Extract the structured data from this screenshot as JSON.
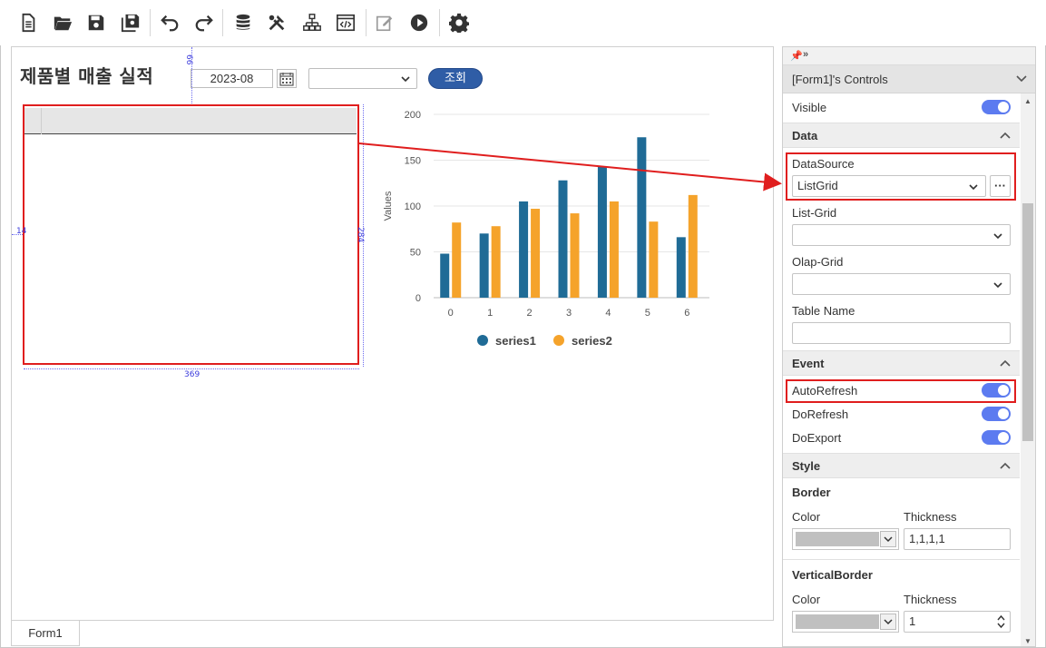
{
  "toolbar": {
    "icons": [
      "new-file-icon",
      "open-folder-icon",
      "save-icon",
      "save-all-icon",
      "undo-icon",
      "redo-icon",
      "database-icon",
      "tools-icon",
      "hierarchy-icon",
      "code-icon",
      "edit-icon",
      "run-icon",
      "settings-icon"
    ]
  },
  "form": {
    "title": "제품별 매출 실적",
    "date_value": "2023-08",
    "select_value": "",
    "query_button": "조회",
    "dim_top": "66",
    "dim_left": "14",
    "dim_height": "284",
    "dim_width": "369"
  },
  "chart_data": {
    "type": "bar",
    "categories": [
      "0",
      "1",
      "2",
      "3",
      "4",
      "5",
      "6"
    ],
    "series": [
      {
        "name": "series1",
        "color": "#1f6b96",
        "values": [
          48,
          70,
          105,
          128,
          143,
          175,
          66
        ]
      },
      {
        "name": "series2",
        "color": "#f5a32b",
        "values": [
          82,
          78,
          97,
          92,
          105,
          83,
          112
        ]
      }
    ],
    "ylabel": "Values",
    "ylim": [
      0,
      200
    ],
    "yticks": [
      "0",
      "50",
      "100",
      "150",
      "200"
    ],
    "grid": true,
    "legend": "bottom"
  },
  "tabs": {
    "form1": "Form1"
  },
  "panel": {
    "title": "[Form1]'s Controls",
    "visible_label": "Visible",
    "data_header": "Data",
    "datasource_label": "DataSource",
    "datasource_value": "ListGrid",
    "ellipsis": "···",
    "listgrid_label": "List-Grid",
    "olapgrid_label": "Olap-Grid",
    "tablename_label": "Table Name",
    "event_header": "Event",
    "autorefresh_label": "AutoRefresh",
    "dorefresh_label": "DoRefresh",
    "doexport_label": "DoExport",
    "style_header": "Style",
    "border_label": "Border",
    "color_label": "Color",
    "thickness_label": "Thickness",
    "border_thickness": "1,1,1,1",
    "verticalborder_label": "VerticalBorder",
    "color_label2": "Color",
    "thickness_label2": "Thickness",
    "vborder_thickness": "1"
  }
}
